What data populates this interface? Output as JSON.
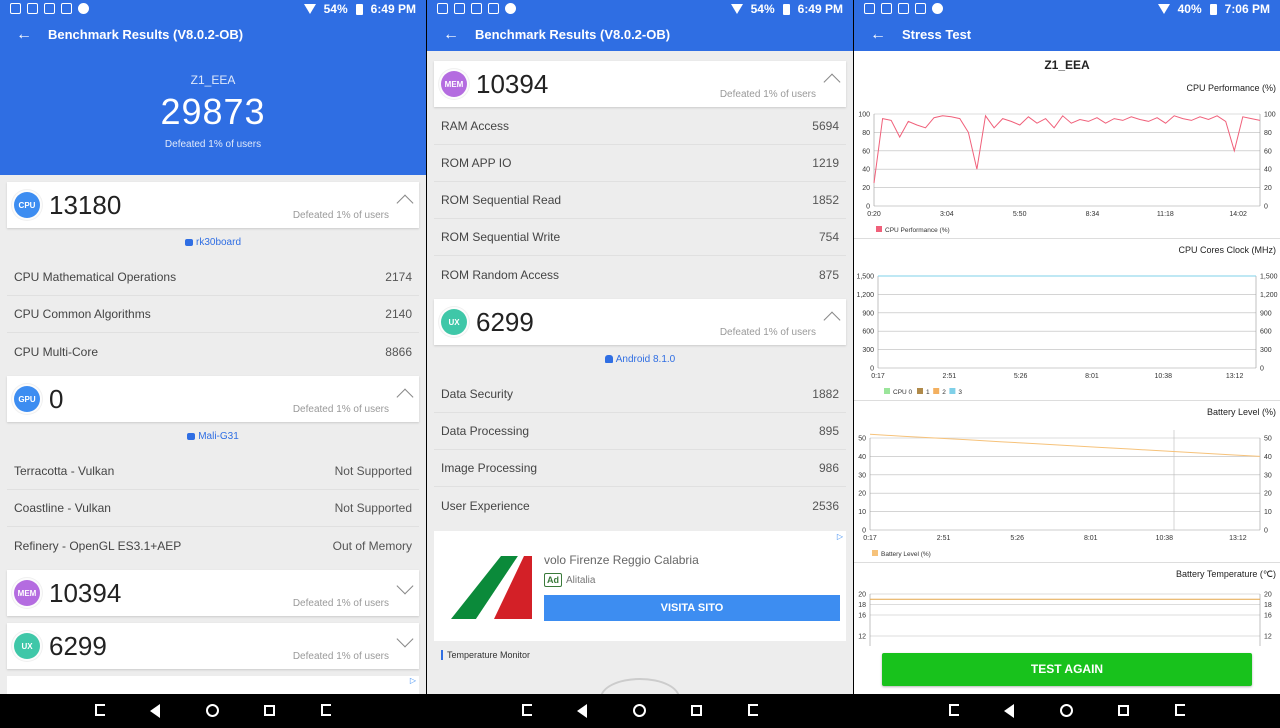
{
  "panel1": {
    "status": {
      "battery": "54%",
      "time": "6:49 PM"
    },
    "title": "Benchmark Results (V8.0.2-OB)",
    "device": "Z1_EEA",
    "total_score": "29873",
    "defeated": "Defeated 1% of users",
    "cpu": {
      "badge": "CPU",
      "score": "13180",
      "defeated": "Defeated 1% of users",
      "board": "rk30board",
      "rows": [
        {
          "label": "CPU Mathematical Operations",
          "value": "2174"
        },
        {
          "label": "CPU Common Algorithms",
          "value": "2140"
        },
        {
          "label": "CPU Multi-Core",
          "value": "8866"
        }
      ]
    },
    "gpu": {
      "badge": "GPU",
      "score": "0",
      "defeated": "Defeated 1% of users",
      "chip": "Mali-G31",
      "rows": [
        {
          "label": "Terracotta - Vulkan",
          "value": "Not Supported"
        },
        {
          "label": "Coastline - Vulkan",
          "value": "Not Supported"
        },
        {
          "label": "Refinery - OpenGL ES3.1+AEP",
          "value": "Out of Memory"
        }
      ]
    },
    "mem": {
      "badge": "MEM",
      "score": "10394",
      "defeated": "Defeated 1% of users"
    },
    "ux": {
      "badge": "UX",
      "score": "6299",
      "defeated": "Defeated 1% of users"
    }
  },
  "panel2": {
    "status": {
      "battery": "54%",
      "time": "6:49 PM"
    },
    "title": "Benchmark Results (V8.0.2-OB)",
    "mem": {
      "badge": "MEM",
      "score": "10394",
      "defeated": "Defeated 1% of users",
      "rows": [
        {
          "label": "RAM Access",
          "value": "5694"
        },
        {
          "label": "ROM APP IO",
          "value": "1219"
        },
        {
          "label": "ROM Sequential Read",
          "value": "1852"
        },
        {
          "label": "ROM Sequential Write",
          "value": "754"
        },
        {
          "label": "ROM Random Access",
          "value": "875"
        }
      ]
    },
    "ux": {
      "badge": "UX",
      "score": "6299",
      "defeated": "Defeated 1% of users",
      "android": "Android 8.1.0",
      "rows": [
        {
          "label": "Data Security",
          "value": "1882"
        },
        {
          "label": "Data Processing",
          "value": "895"
        },
        {
          "label": "Image Processing",
          "value": "986"
        },
        {
          "label": "User Experience",
          "value": "2536"
        }
      ]
    },
    "ad": {
      "title": "volo Firenze Reggio Calabria",
      "tag": "Ad",
      "advertiser": "Alitalia",
      "button": "VISITA SITO"
    },
    "section": "Temperature Monitor"
  },
  "panel3": {
    "status": {
      "battery": "40%",
      "time": "7:06 PM"
    },
    "title": "Stress Test",
    "device": "Z1_EEA",
    "button": "TEST AGAIN",
    "charts": {
      "cpu_perf": {
        "title": "CPU Performance (%)",
        "legend": [
          "CPU Performance (%)"
        ],
        "color": "#f0607a",
        "y_ticks": [
          "0",
          "20",
          "40",
          "60",
          "80",
          "100"
        ],
        "x_ticks": [
          "0:20",
          "3:04",
          "5:50",
          "8:34",
          "11:18",
          "14:02"
        ]
      },
      "cpu_clock": {
        "title": "CPU Cores Clock (MHz)",
        "legend": [
          "CPU 0",
          "1",
          "2",
          "3"
        ],
        "legend_colors": [
          "#9be59b",
          "#b08a4a",
          "#f3b060",
          "#7fd0e8"
        ],
        "y_ticks": [
          "0",
          "300",
          "600",
          "900",
          "1,200",
          "1,500"
        ],
        "x_ticks": [
          "0:17",
          "2:51",
          "5:26",
          "8:01",
          "10:38",
          "13:12"
        ]
      },
      "battery": {
        "title": "Battery Level (%)",
        "legend": [
          "Battery Level (%)"
        ],
        "color": "#f6c27a",
        "y_ticks": [
          "0",
          "10",
          "20",
          "30",
          "40",
          "50"
        ],
        "x_ticks": [
          "0:17",
          "2:51",
          "5:26",
          "8:01",
          "10:38",
          "13:12"
        ]
      },
      "battery_temp": {
        "title": "Battery Temperature (℃)",
        "color": "#e3a64a",
        "y_ticks": [
          "12",
          "16",
          "18",
          "20"
        ]
      }
    }
  },
  "chart_data": [
    {
      "type": "line",
      "title": "CPU Performance (%)",
      "x": [
        "0:20",
        "3:04",
        "5:50",
        "8:34",
        "11:18",
        "14:02"
      ],
      "ylim": [
        0,
        100
      ],
      "series": [
        {
          "name": "CPU Performance (%)",
          "values": [
            25,
            95,
            93,
            75,
            92,
            88,
            85,
            96,
            98,
            97,
            95,
            80,
            40,
            98,
            85,
            95,
            92,
            88,
            97,
            90,
            95,
            85,
            98,
            90,
            94,
            92,
            96,
            90,
            95,
            93,
            97,
            94,
            92,
            96,
            90,
            98,
            95,
            93,
            97,
            94,
            98,
            92,
            60,
            97,
            95,
            93
          ]
        }
      ]
    },
    {
      "type": "line",
      "title": "CPU Cores Clock (MHz)",
      "x": [
        "0:17",
        "2:51",
        "5:26",
        "8:01",
        "10:38",
        "13:12"
      ],
      "ylim": [
        0,
        1500
      ],
      "series": [
        {
          "name": "CPU 0",
          "values": [
            1500,
            1500,
            1500,
            1500,
            1500,
            1500
          ]
        },
        {
          "name": "1",
          "values": [
            1500,
            1500,
            1500,
            1500,
            1500,
            1500
          ]
        },
        {
          "name": "2",
          "values": [
            1500,
            1500,
            1500,
            1500,
            1500,
            1500
          ]
        },
        {
          "name": "3",
          "values": [
            1500,
            1500,
            1500,
            1500,
            1500,
            1500
          ]
        }
      ]
    },
    {
      "type": "line",
      "title": "Battery Level (%)",
      "x": [
        "0:17",
        "2:51",
        "5:26",
        "8:01",
        "10:38",
        "13:12"
      ],
      "ylim": [
        0,
        50
      ],
      "series": [
        {
          "name": "Battery Level (%)",
          "values": [
            52,
            51,
            50,
            49,
            48,
            47,
            46,
            45,
            44,
            43,
            42,
            41,
            40
          ]
        }
      ]
    },
    {
      "type": "line",
      "title": "Battery Temperature (℃)",
      "ylim": [
        12,
        20
      ],
      "series": [
        {
          "values": [
            19,
            19,
            19,
            19,
            19
          ]
        }
      ]
    }
  ]
}
